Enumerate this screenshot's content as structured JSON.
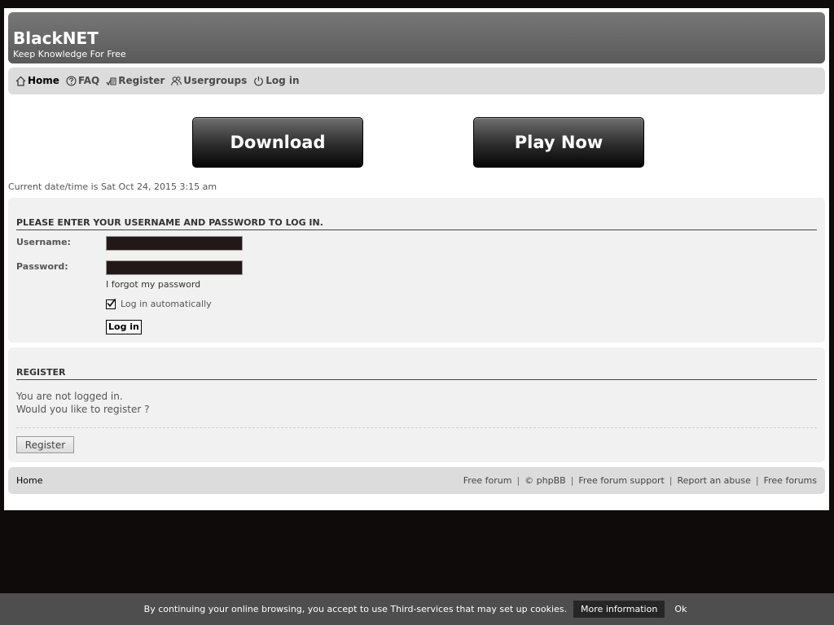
{
  "header": {
    "title": "BlackNET",
    "description": "Keep Knowledge For Free"
  },
  "nav": {
    "items": [
      {
        "label": "Home",
        "icon": "home-icon"
      },
      {
        "label": "FAQ",
        "icon": "question-icon"
      },
      {
        "label": "Register",
        "icon": "register-icon"
      },
      {
        "label": "Usergroups",
        "icon": "usergroups-icon"
      },
      {
        "label": "Log in",
        "icon": "power-icon"
      }
    ]
  },
  "banners": {
    "download": "Download",
    "play": "Play Now"
  },
  "datetime": "Current date/time is Sat Oct 24, 2015 3:15 am",
  "login": {
    "heading": "PLEASE ENTER YOUR USERNAME AND PASSWORD TO LOG IN.",
    "username_label": "Username:",
    "password_label": "Password:",
    "username_value": "",
    "password_value": "",
    "forgot": "I forgot my password",
    "autologin": "Log in automatically",
    "autologin_checked": true,
    "submit": "Log in"
  },
  "register": {
    "heading": "REGISTER",
    "line1": "You are not logged in.",
    "line2": "Would you like to register ?",
    "button": "Register"
  },
  "footer": {
    "home": "Home",
    "links": [
      "Free forum",
      "© phpBB",
      "Free forum support",
      "Report an abuse",
      "Free forums"
    ]
  },
  "cookie": {
    "text": "By continuing your online browsing, you accept to use Third-services that may set up cookies.",
    "more": "More information",
    "ok": "Ok"
  }
}
